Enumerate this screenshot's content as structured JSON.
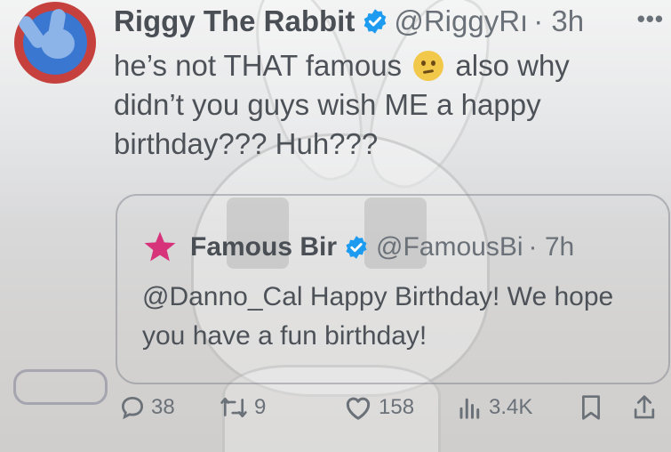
{
  "tweet": {
    "display_name": "Riggy The Rabbit",
    "handle": "@RiggyRı",
    "time": "· 3h",
    "more": "•••",
    "text_part1": "he’s not THAT famous ",
    "text_part2": " also why didn’t you guys wish ME a happy birthday??? Huh???"
  },
  "quoted": {
    "display_name": "Famous Bir",
    "handle": "@FamousBi",
    "time": "· 7h",
    "text": "@Danno_Cal Happy Birthday! We hope you have a fun birthday!"
  },
  "actions": {
    "replies": "38",
    "reposts": "9",
    "likes": "158",
    "views": "3.4K"
  },
  "colors": {
    "verified": "#1d9bf0",
    "star": "#d6337a",
    "avatar_ring": "#c6403e",
    "avatar_fill": "#3a77d0"
  },
  "icons": [
    "verified-badge-icon",
    "more-icon",
    "sad-emoji-icon",
    "star-icon",
    "reply-icon",
    "repost-icon",
    "like-icon",
    "views-icon",
    "bookmark-icon",
    "share-icon"
  ]
}
